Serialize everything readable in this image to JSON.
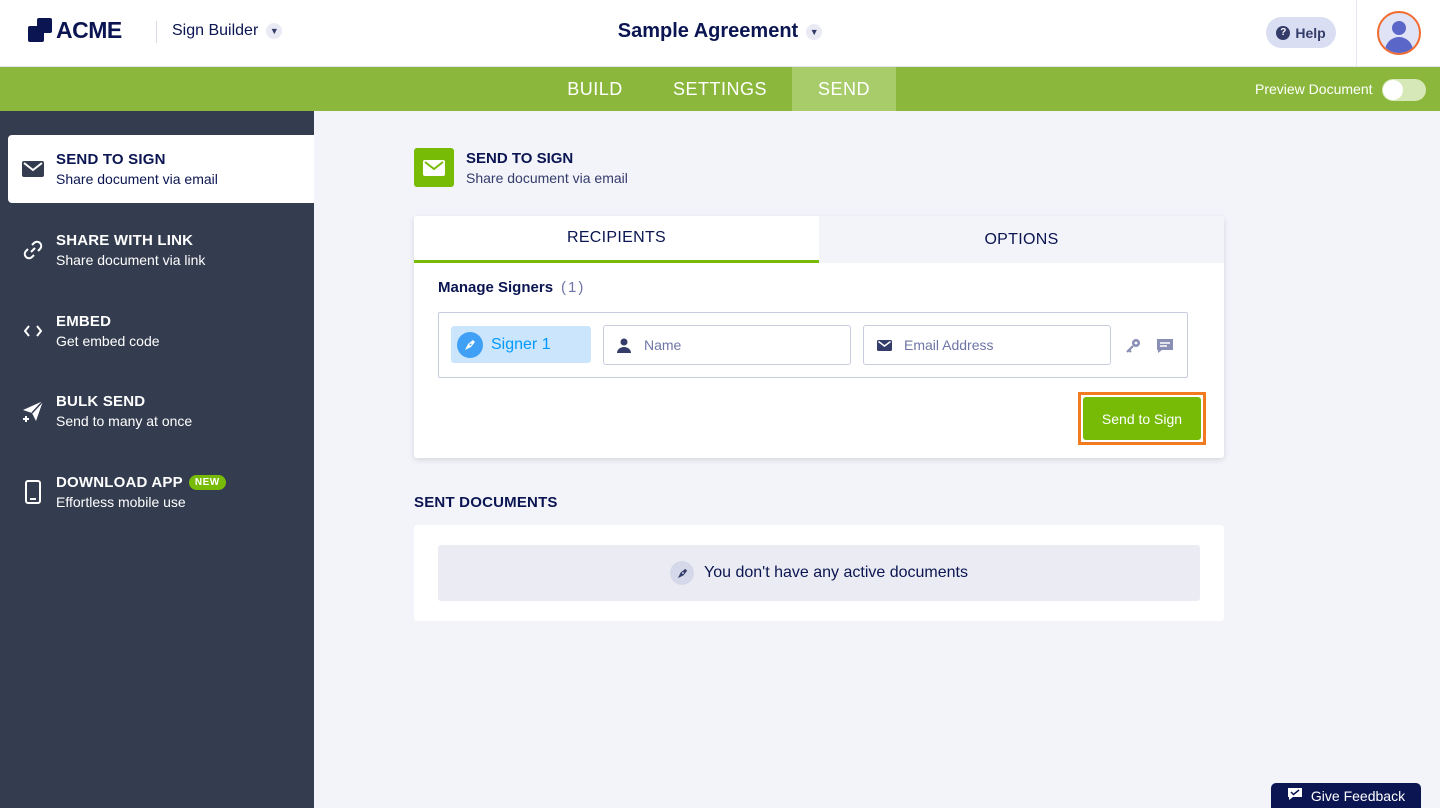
{
  "header": {
    "logo_text": "ACME",
    "builder_label": "Sign Builder",
    "document_title": "Sample Agreement",
    "help_label": "Help"
  },
  "nav": {
    "tabs": [
      {
        "label": "BUILD",
        "active": false
      },
      {
        "label": "SETTINGS",
        "active": false
      },
      {
        "label": "SEND",
        "active": true
      }
    ],
    "preview_label": "Preview Document",
    "preview_enabled": false
  },
  "sidebar": {
    "items": [
      {
        "title": "SEND TO SIGN",
        "subtitle": "Share document via email",
        "icon": "envelope-icon",
        "active": true
      },
      {
        "title": "SHARE WITH LINK",
        "subtitle": "Share document via link",
        "icon": "link-icon",
        "active": false
      },
      {
        "title": "EMBED",
        "subtitle": "Get embed code",
        "icon": "code-icon",
        "active": false
      },
      {
        "title": "BULK SEND",
        "subtitle": "Send to many at once",
        "icon": "paper-plane-icon",
        "active": false
      },
      {
        "title": "DOWNLOAD APP",
        "subtitle": "Effortless mobile use",
        "icon": "phone-icon",
        "badge": "NEW",
        "active": false
      }
    ]
  },
  "main": {
    "section_title": "SEND TO SIGN",
    "section_subtitle": "Share document via email",
    "tabs": [
      {
        "label": "RECIPIENTS",
        "active": true
      },
      {
        "label": "OPTIONS",
        "active": false
      }
    ],
    "manage_label": "Manage Signers",
    "signer_count": "(1)",
    "signer": {
      "label": "Signer 1",
      "name_placeholder": "Name",
      "email_placeholder": "Email Address",
      "name_value": "",
      "email_value": ""
    },
    "send_button": "Send to Sign",
    "sent_title": "SENT DOCUMENTS",
    "empty_message": "You don't have any active documents"
  },
  "feedback_label": "Give Feedback",
  "colors": {
    "brand_green": "#78bb07",
    "nav_green": "#8bb83c",
    "navy": "#0a1551",
    "sidebar": "#343c4f",
    "highlight": "#f27b20",
    "signer_blue": "#0099ff"
  }
}
